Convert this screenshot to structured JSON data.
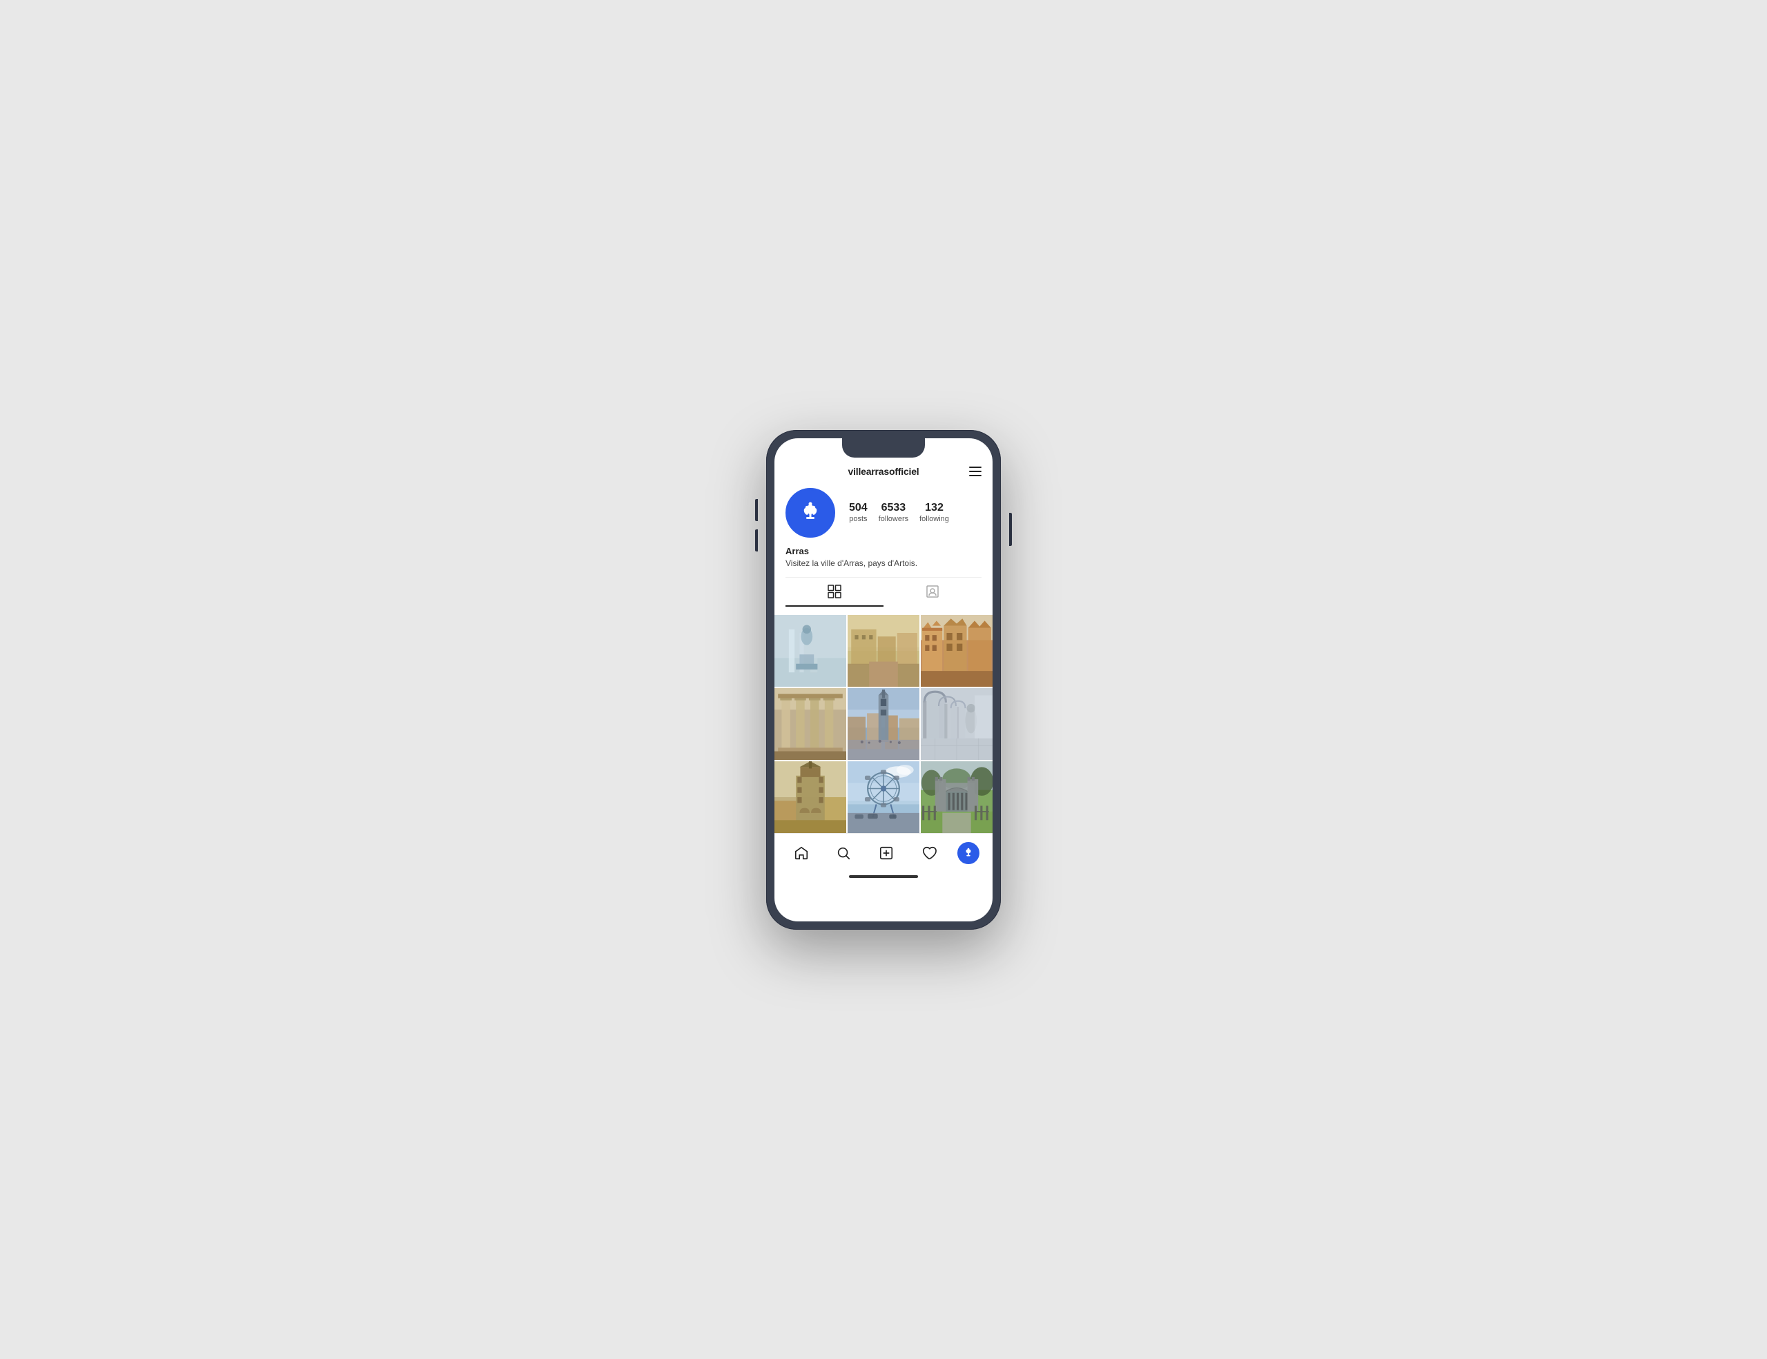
{
  "phone": {
    "notch": true
  },
  "header": {
    "username": "villearrasofficiel",
    "menu_label": "menu"
  },
  "profile": {
    "name": "Arras",
    "bio": "Visitez la ville d'Arras, pays d'Artois.",
    "stats": {
      "posts": {
        "number": "504",
        "label": "posts"
      },
      "followers": {
        "number": "6533",
        "label": "followers"
      },
      "following": {
        "number": "132",
        "label": "following"
      }
    }
  },
  "tabs": {
    "grid": {
      "label": "grid-view"
    },
    "tagged": {
      "label": "tagged-view"
    }
  },
  "grid": {
    "photos": [
      {
        "id": 1,
        "alt": "statue fountain",
        "class": "photo-1"
      },
      {
        "id": 2,
        "alt": "garden courtyard",
        "class": "photo-2"
      },
      {
        "id": 3,
        "alt": "flemish architecture",
        "class": "photo-3"
      },
      {
        "id": 4,
        "alt": "classical building columns",
        "class": "photo-4"
      },
      {
        "id": 5,
        "alt": "arras belfry square",
        "class": "photo-5"
      },
      {
        "id": 6,
        "alt": "gothic arches corridor",
        "class": "photo-6"
      },
      {
        "id": 7,
        "alt": "belfry tower",
        "class": "photo-7"
      },
      {
        "id": 8,
        "alt": "ferris wheel",
        "class": "photo-8"
      },
      {
        "id": 9,
        "alt": "park gate green",
        "class": "photo-9"
      }
    ]
  },
  "bottom_nav": {
    "home": "home",
    "search": "search",
    "add": "add-post",
    "activity": "activity",
    "profile": "profile"
  }
}
